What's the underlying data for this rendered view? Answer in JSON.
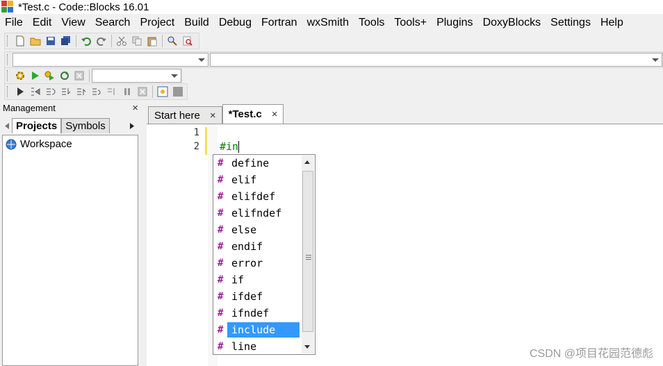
{
  "window": {
    "title": "*Test.c - Code::Blocks 16.01"
  },
  "menu": [
    "File",
    "Edit",
    "View",
    "Search",
    "Project",
    "Build",
    "Debug",
    "Fortran",
    "wxSmith",
    "Tools",
    "Tools+",
    "Plugins",
    "DoxyBlocks",
    "Settings",
    "Help"
  ],
  "management": {
    "title": "Management",
    "close": "×",
    "tabs": [
      "Projects",
      "Symbols"
    ],
    "workspace": "Workspace"
  },
  "editor": {
    "tabs": [
      {
        "label": "Start here",
        "close": "×"
      },
      {
        "label": "*Test.c",
        "close": "×"
      }
    ],
    "lines": [
      {
        "no": "1",
        "text": ""
      },
      {
        "no": "2",
        "text": "#in"
      }
    ]
  },
  "autocomplete": {
    "items": [
      "define",
      "elif",
      "elifdef",
      "elifndef",
      "else",
      "endif",
      "error",
      "if",
      "ifdef",
      "ifndef",
      "include",
      "line"
    ],
    "selected": "include",
    "hash": "#"
  },
  "watermark": "CSDN @项目花园范德彪",
  "colors": {
    "selection": "#3399ff",
    "preprocessor": "#008000",
    "hash": "#9b1f9b",
    "changebar": "#f5e050"
  }
}
